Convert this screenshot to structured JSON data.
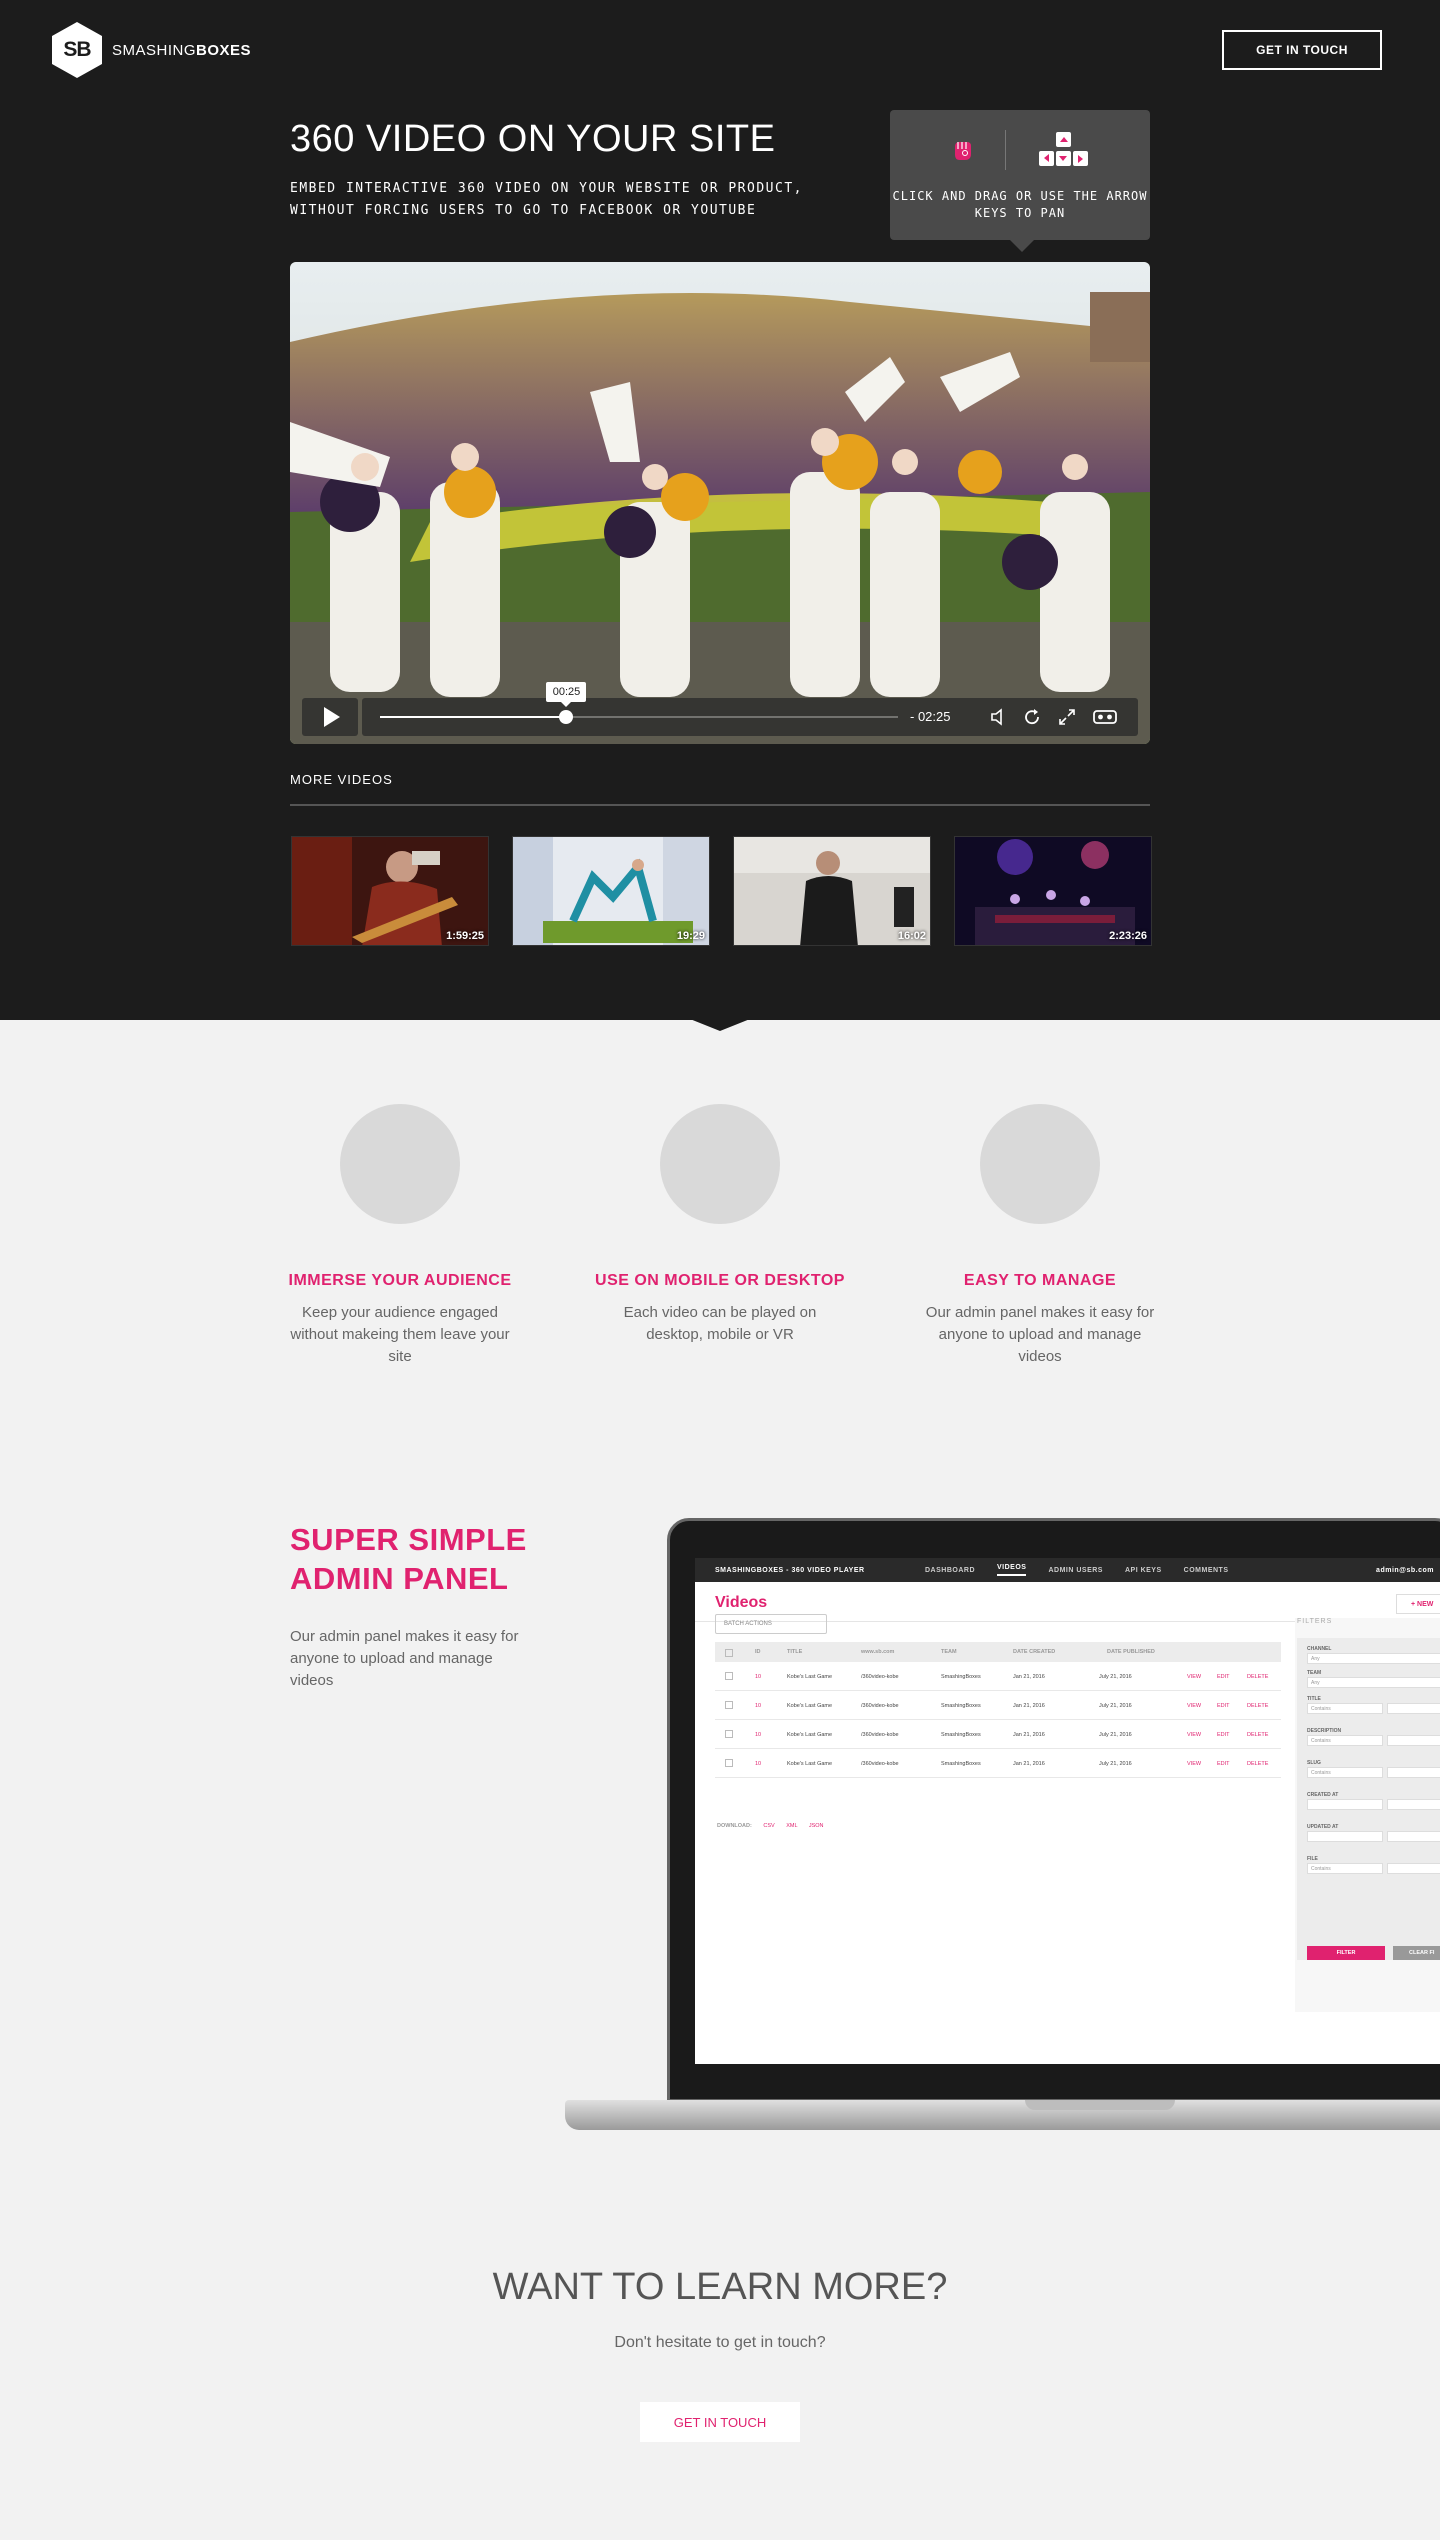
{
  "brand": {
    "logo_mark": "SB",
    "name_light": "SMASHING",
    "name_bold": "BOXES"
  },
  "nav": {
    "cta_label": "GET IN TOUCH"
  },
  "hero": {
    "title": "360 VIDEO ON YOUR SITE",
    "subtitle": "EMBED INTERACTIVE 360 VIDEO ON YOUR WEBSITE OR PRODUCT, WITHOUT FORCING USERS TO GO TO FACEBOOK OR YOUTUBE"
  },
  "tip": {
    "text": "CLICK AND DRAG OR USE THE ARROW KEYS TO PAN",
    "icons": [
      "drag-hand-icon",
      "arrow-keys-icon"
    ]
  },
  "player": {
    "current_time": "00:25",
    "remaining": "- 02:25",
    "progress": 0.36,
    "icons": [
      "play-icon",
      "volume-icon",
      "replay-icon",
      "fullscreen-icon",
      "vr-icon"
    ]
  },
  "more_videos": {
    "label": "MORE VIDEOS",
    "items": [
      {
        "duration": "1:59:25"
      },
      {
        "duration": "19:29"
      },
      {
        "duration": "16:02"
      },
      {
        "duration": "2:23:26"
      }
    ]
  },
  "features": [
    {
      "title": "IMMERSE YOUR AUDIENCE",
      "desc": "Keep your audience engaged without makeing them leave your site"
    },
    {
      "title": "USE ON MOBILE OR DESKTOP",
      "desc": "Each video can be played on desktop, mobile or VR"
    },
    {
      "title": "EASY TO MANAGE",
      "desc": "Our admin panel makes it easy for anyone to upload and manage videos"
    }
  ],
  "admin": {
    "title_line1": "SUPER SIMPLE",
    "title_line2": "ADMIN PANEL",
    "desc": "Our admin panel makes it easy for anyone to upload and manage videos",
    "screen": {
      "brand": "SMASHINGBOXES - 360 VIDEO PLAYER",
      "nav": [
        "DASHBOARD",
        "VIDEOS",
        "ADMIN USERS",
        "API KEYS",
        "COMMENTS"
      ],
      "user": "admin@sb.com",
      "page_title": "Videos",
      "new_label": "+ NEW",
      "batch_label": "BATCH ACTIONS",
      "columns": [
        "ID",
        "TITLE",
        "www.sb.com",
        "TEAM",
        "DATE CREATED",
        "DATE PUBLISHED"
      ],
      "rows": [
        {
          "id": "10",
          "title": "Kobe's Last Game",
          "slug": "/360video-kobe",
          "team": "SmashingBoxes",
          "created": "Jan 21, 2016",
          "published": "July 21, 2016"
        },
        {
          "id": "10",
          "title": "Kobe's Last Game",
          "slug": "/360video-kobe",
          "team": "SmashingBoxes",
          "created": "Jan 21, 2016",
          "published": "July 21, 2016"
        },
        {
          "id": "10",
          "title": "Kobe's Last Game",
          "slug": "/360video-kobe",
          "team": "SmashingBoxes",
          "created": "Jan 21, 2016",
          "published": "July 21, 2016"
        },
        {
          "id": "10",
          "title": "Kobe's Last Game",
          "slug": "/360video-kobe",
          "team": "SmashingBoxes",
          "created": "Jan 21, 2016",
          "published": "July 21, 2016"
        }
      ],
      "row_actions": [
        "VIEW",
        "EDIT",
        "DELETE"
      ],
      "download_label": "DOWNLOAD:",
      "download_formats": [
        "CSV",
        "XML",
        "JSON"
      ],
      "filters_label": "FILTERS",
      "filter_fields": [
        "CHANNEL",
        "TEAM",
        "TITLE",
        "DESCRIPTION",
        "SLUG",
        "CREATED AT",
        "UPDATED AT",
        "FILE"
      ],
      "filter_any": "Any",
      "filter_contains": "Contains",
      "filter_btn": "FILTER",
      "clear_btn": "CLEAR FI"
    }
  },
  "cta": {
    "title": "WANT TO LEARN MORE?",
    "subtitle": "Don't hesitate to get in touch?",
    "button": "GET IN TOUCH"
  },
  "colors": {
    "accent": "#e0226f",
    "dark": "#1c1c1c",
    "light_bg": "#f2f2f2"
  }
}
